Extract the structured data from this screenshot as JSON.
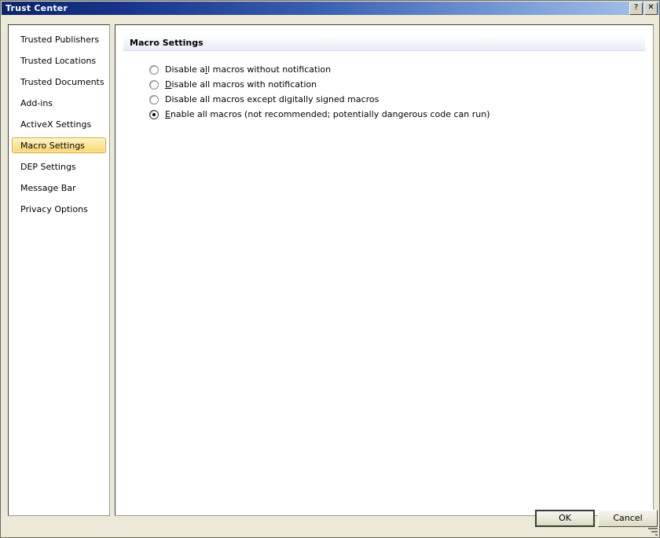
{
  "window": {
    "title": "Trust Center",
    "help_button": "?",
    "close_button": "✕"
  },
  "sidebar": {
    "items": [
      {
        "label": "Trusted Publishers",
        "selected": false
      },
      {
        "label": "Trusted Locations",
        "selected": false
      },
      {
        "label": "Trusted Documents",
        "selected": false
      },
      {
        "label": "Add-ins",
        "selected": false
      },
      {
        "label": "ActiveX Settings",
        "selected": false
      },
      {
        "label": "Macro Settings",
        "selected": true
      },
      {
        "label": "DEP Settings",
        "selected": false
      },
      {
        "label": "Message Bar",
        "selected": false
      },
      {
        "label": "Privacy Options",
        "selected": false
      }
    ],
    "selected_color": "#f8d671",
    "selected_border_color": "#e3a21a"
  },
  "main": {
    "header_title": "Macro Settings",
    "radio_options": [
      {
        "label": "Disable all macros without notification",
        "before": "Disable a",
        "accel": "l",
        "after": "l macros without notification",
        "checked": false
      },
      {
        "label": "Disable all macros with notification",
        "before": "",
        "accel": "D",
        "after": "isable all macros with notification",
        "checked": false
      },
      {
        "label": "Disable all macros except digitally signed macros",
        "before": "Disable all macros except di",
        "accel": "g",
        "after": "itally signed macros",
        "checked": false
      },
      {
        "label": "Enable all macros (not recommended; potentially dangerous code can run)",
        "before": "",
        "accel": "E",
        "after": "nable all macros (not recommended; potentially dangerous code can run)",
        "checked": true
      }
    ]
  },
  "footer": {
    "ok_label": "OK",
    "cancel_label": "Cancel"
  }
}
